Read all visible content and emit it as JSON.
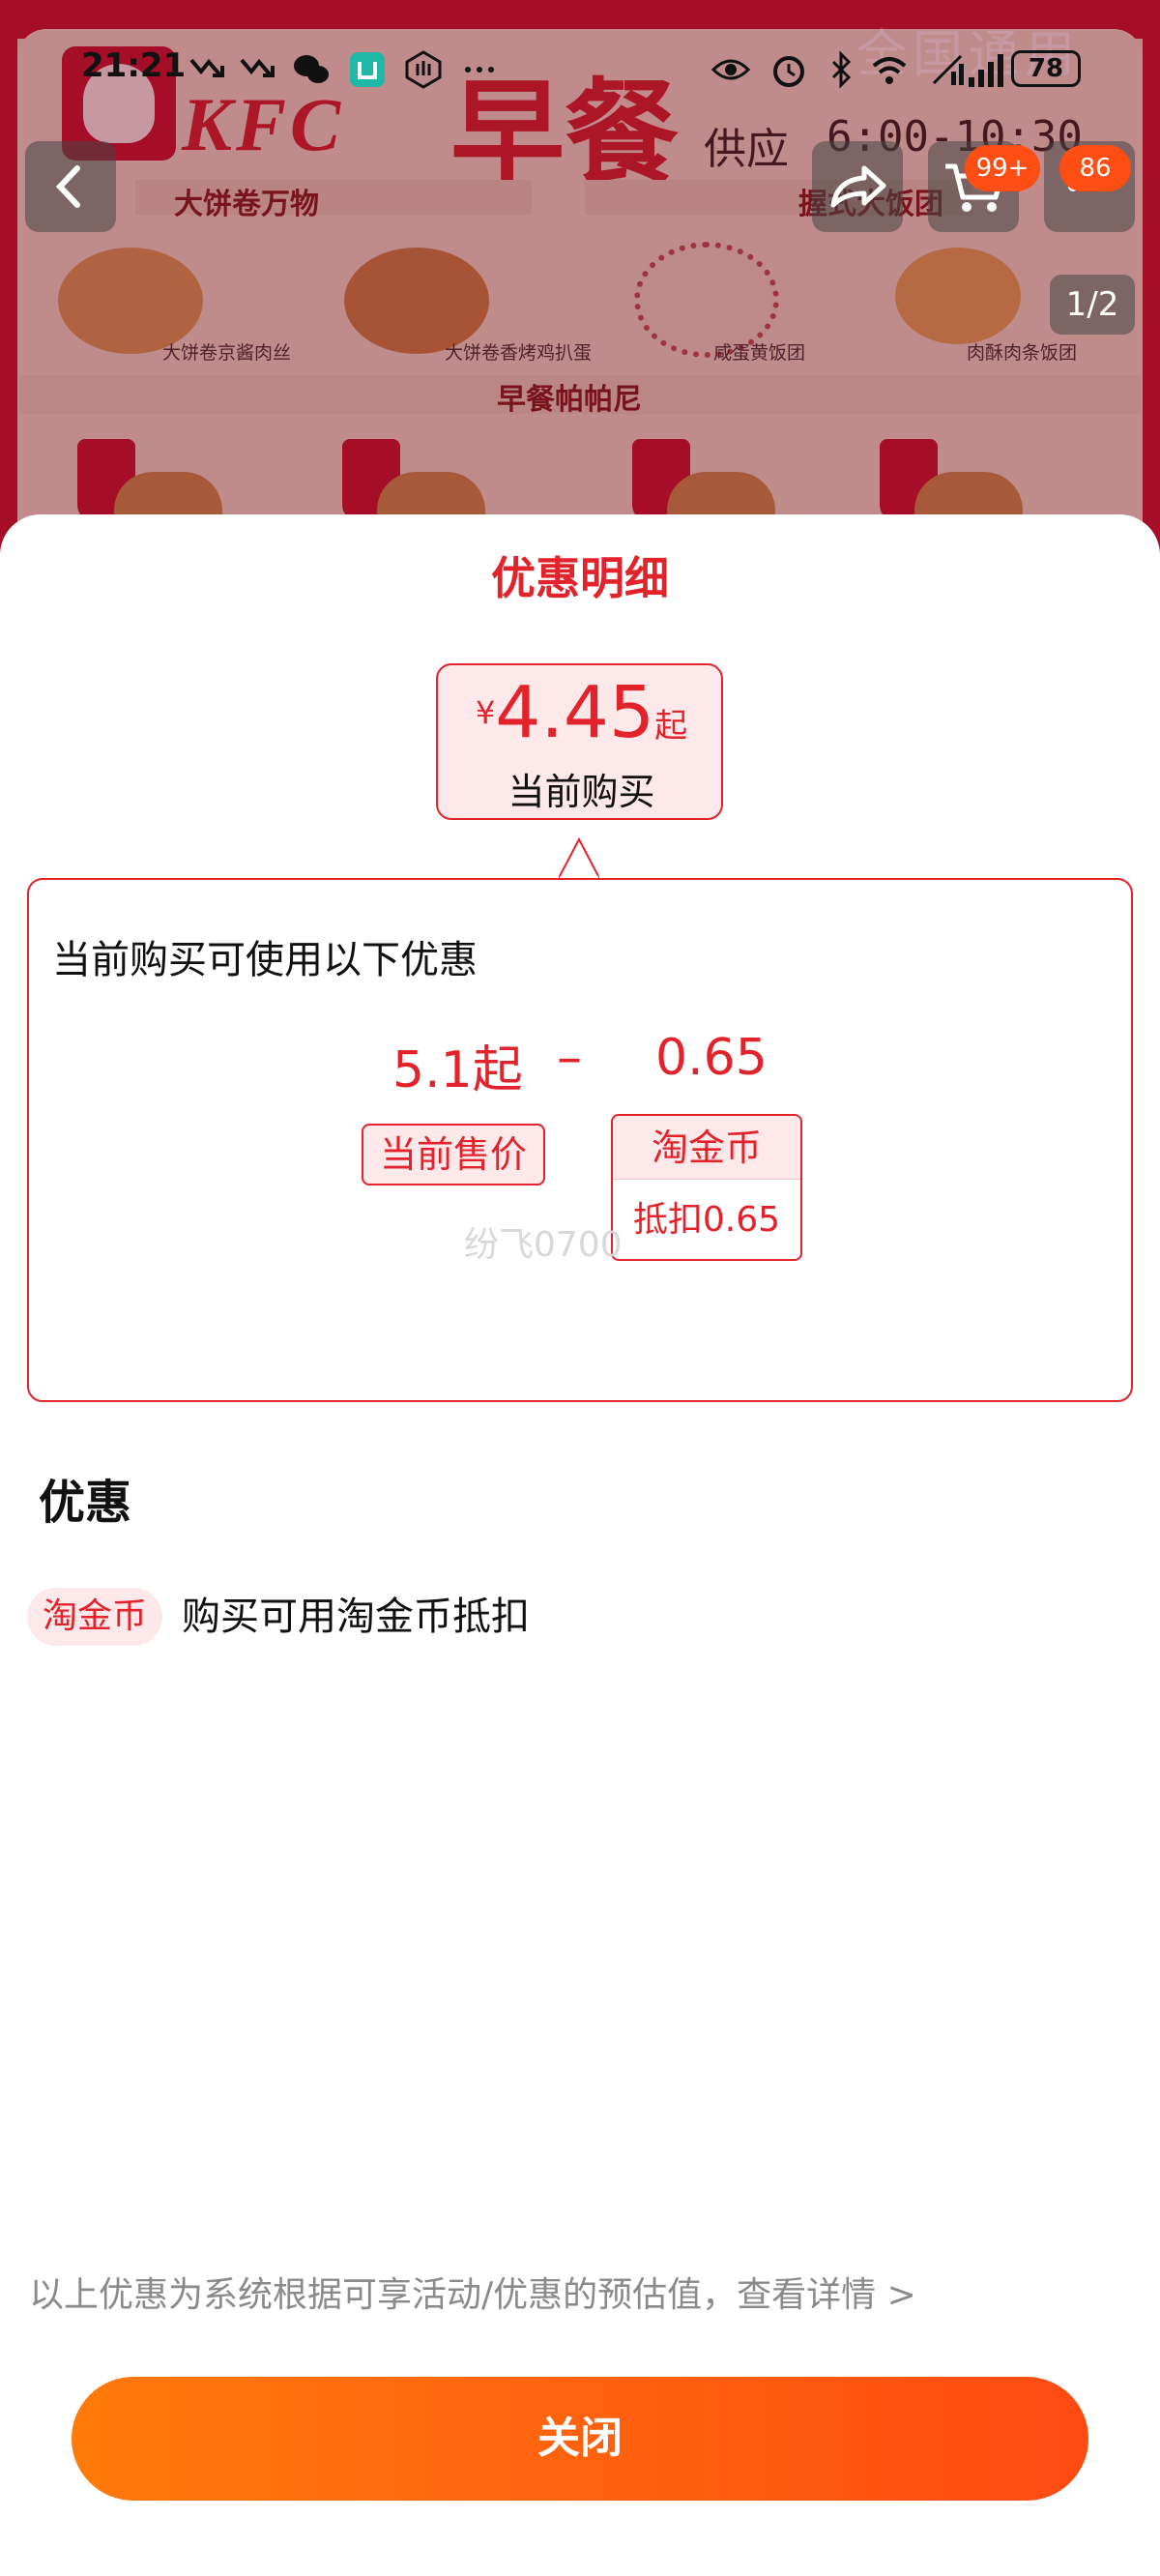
{
  "status_bar": {
    "time": "21:21",
    "battery": "78"
  },
  "banner": {
    "brand": "KFC",
    "headline": "早餐",
    "scope": "全国通用",
    "supply_label": "供应",
    "supply_time": "6:00-10:30",
    "category_1": "大饼卷万物",
    "category_2": "握式大饭团",
    "category_3": "早餐帕帕尼",
    "items": [
      "大饼卷京酱肉丝",
      "大饼卷香烤鸡扒蛋",
      "咸蛋黄饭团",
      "肉酥肉条饭团"
    ],
    "page_indicator": "1/2"
  },
  "nav": {
    "cart_badge": "99+",
    "more_badge": "86"
  },
  "sheet": {
    "title": "优惠明细",
    "price": {
      "currency": "¥",
      "amount": "4.45",
      "suffix": "起",
      "label": "当前购买"
    },
    "detail": {
      "heading": "当前购买可使用以下优惠",
      "original_value": "5.1起",
      "operator": "–",
      "discount_value": "0.65",
      "original_label": "当前售价",
      "discount_label": "淘金币",
      "discount_sub": "抵扣0.65",
      "watermark": "纷飞0700"
    },
    "section_title": "优惠",
    "coupon": {
      "tag": "淘金币",
      "desc": "购买可用淘金币抵扣"
    },
    "footnote": "以上优惠为系统根据可享活动/优惠的预估值，查看详情 >",
    "close_label": "关闭"
  },
  "colors": {
    "accent": "#e2232c",
    "button_start": "#ff7a0b",
    "button_end": "#ff4a12"
  }
}
